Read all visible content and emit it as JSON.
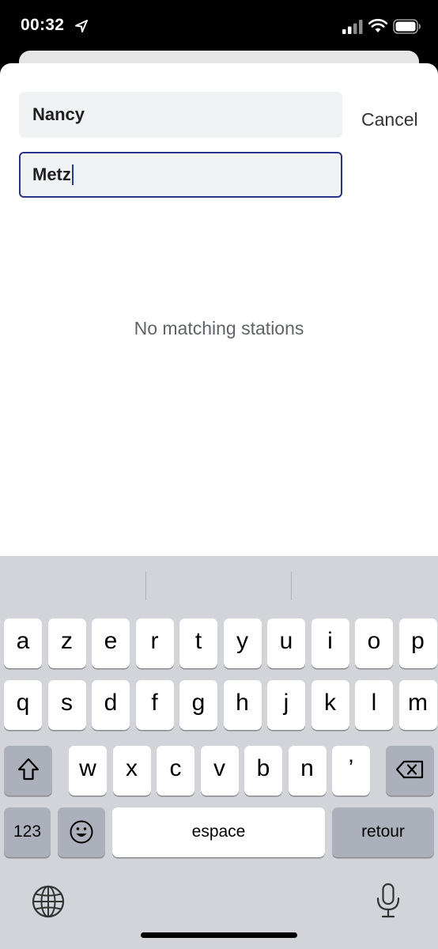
{
  "status_bar": {
    "time": "00:32",
    "icons": [
      "location-arrow-icon",
      "cellular-signal-icon",
      "wifi-icon",
      "battery-icon"
    ]
  },
  "search": {
    "from_value": "Nancy",
    "to_value": "Metz",
    "cancel_label": "Cancel",
    "empty_message": "No matching stations",
    "focus_color": "#27348b"
  },
  "keyboard": {
    "row1": [
      "a",
      "z",
      "e",
      "r",
      "t",
      "y",
      "u",
      "i",
      "o",
      "p"
    ],
    "row2": [
      "q",
      "s",
      "d",
      "f",
      "g",
      "h",
      "j",
      "k",
      "l",
      "m"
    ],
    "row3": [
      "w",
      "x",
      "c",
      "v",
      "b",
      "n",
      "’"
    ],
    "numbers_label": "123",
    "space_label": "espace",
    "return_label": "retour",
    "function_icons": [
      "shift-icon",
      "backspace-icon",
      "emoji-icon",
      "globe-icon",
      "microphone-icon"
    ]
  }
}
